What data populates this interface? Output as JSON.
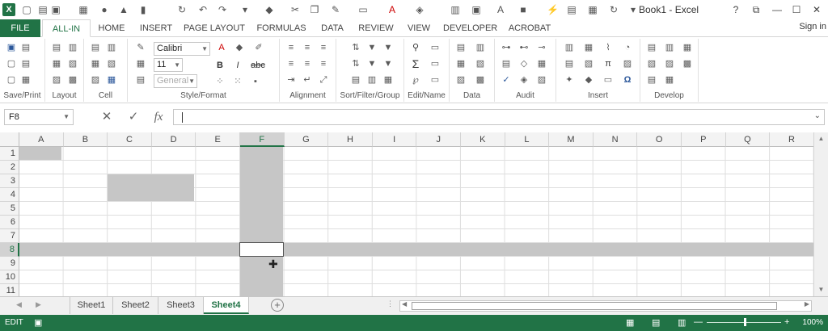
{
  "window": {
    "title": "Book1 - Excel",
    "help": "?",
    "controls": [
      "⧉",
      "—",
      "☐",
      "✕"
    ]
  },
  "tabs": [
    "FILE",
    "ALL-IN",
    "HOME",
    "INSERT",
    "PAGE LAYOUT",
    "FORMULAS",
    "DATA",
    "REVIEW",
    "VIEW",
    "DEVELOPER",
    "ACROBAT"
  ],
  "active_tab": "ALL-IN",
  "sign_in": "Sign in",
  "ribbon": {
    "font_name": "Calibri",
    "font_size": "11",
    "number_format": "General",
    "groups": [
      "Save/Print",
      "Layout",
      "Cell",
      "Style/Format",
      "Alignment",
      "Sort/Filter/Group",
      "Edit/Name",
      "Data",
      "Audit",
      "Insert",
      "Develop"
    ],
    "bold": "B",
    "italic": "I",
    "strike": "abc",
    "sigma": "Σ",
    "pi": "π",
    "omega": "Ω"
  },
  "formula_bar": {
    "name_box": "F8",
    "cancel": "✕",
    "enter": "✓",
    "fx": "fx",
    "value": ""
  },
  "grid": {
    "columns": [
      "A",
      "B",
      "C",
      "D",
      "E",
      "F",
      "G",
      "H",
      "I",
      "J",
      "K",
      "L",
      "M",
      "N",
      "O",
      "P",
      "Q",
      "R"
    ],
    "rows": [
      "1",
      "2",
      "3",
      "4",
      "5",
      "6",
      "7",
      "8",
      "9",
      "10",
      "11"
    ],
    "active_cell": "F8",
    "selected_column": "F",
    "selected_row": "8",
    "selection_ranges": [
      "A1",
      "C3:D4",
      "F:F",
      "8:8"
    ]
  },
  "sheets": [
    "Sheet1",
    "Sheet2",
    "Sheet3",
    "Sheet4"
  ],
  "active_sheet": "Sheet4",
  "status": {
    "mode": "EDIT",
    "zoom": "100%",
    "zoom_minus": "—",
    "zoom_plus": "+"
  },
  "colors": {
    "accent": "#217346",
    "selection": "#c6c6c6"
  }
}
